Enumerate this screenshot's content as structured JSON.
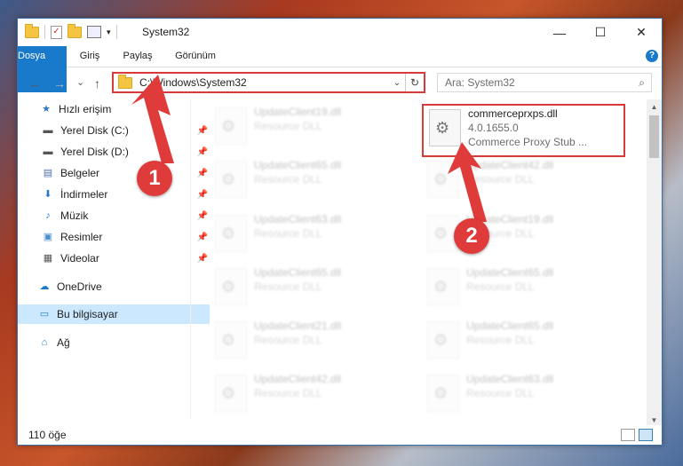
{
  "window": {
    "title": "System32",
    "minimize": "—",
    "maximize": "☐",
    "close": "✕"
  },
  "ribbon": {
    "tabs": [
      "Dosya",
      "Giriş",
      "Paylaş",
      "Görünüm"
    ],
    "help": "?"
  },
  "nav": {
    "back": "←",
    "forward": "→",
    "recent": "⌄",
    "up": "↑"
  },
  "address": {
    "path": "C:\\Windows\\System32",
    "dropdown": "⌄",
    "refresh": "↻"
  },
  "search": {
    "placeholder": "Ara: System32",
    "icon": "⌕"
  },
  "sidebar": {
    "items": [
      {
        "label": "Hızlı erişim",
        "icon": "★",
        "pinned": false
      },
      {
        "label": "Yerel Disk (C:)",
        "icon": "▬",
        "pinned": true
      },
      {
        "label": "Yerel Disk (D:)",
        "icon": "▬",
        "pinned": true
      },
      {
        "label": "Belgeler",
        "icon": "▤",
        "pinned": true
      },
      {
        "label": "İndirmeler",
        "icon": "⬇",
        "pinned": true
      },
      {
        "label": "Müzik",
        "icon": "♪",
        "pinned": true
      },
      {
        "label": "Resimler",
        "icon": "▣",
        "pinned": true
      },
      {
        "label": "Videolar",
        "icon": "▦",
        "pinned": true
      },
      {
        "label": "OneDrive",
        "icon": "☁",
        "pinned": false
      },
      {
        "label": "Bu bilgisayar",
        "icon": "▭",
        "pinned": false
      },
      {
        "label": "Ağ",
        "icon": "⌂",
        "pinned": false
      }
    ],
    "pin_glyph": "📌"
  },
  "files": {
    "left_column": [
      {
        "name": "UpdateClient19.dll",
        "type": "Resource DLL"
      },
      {
        "name": "UpdateClient65.dll",
        "type": "Resource DLL"
      },
      {
        "name": "UpdateClient63.dll",
        "type": "Resource DLL"
      },
      {
        "name": "UpdateClient65.dll",
        "type": "Resource DLL"
      },
      {
        "name": "UpdateClient21.dll",
        "type": "Resource DLL"
      },
      {
        "name": "UpdateClient42.dll",
        "type": "Resource DLL"
      }
    ],
    "right_column": [
      {
        "name": "UpdateClient42.dll",
        "type": "Resource DLL"
      },
      {
        "name": "UpdateClient19.dll",
        "type": "Resource DLL"
      },
      {
        "name": "UpdateClient65.dll",
        "type": "Resource DLL"
      },
      {
        "name": "UpdateClient65.dll",
        "type": "Resource DLL"
      },
      {
        "name": "UpdateClient63.dll",
        "type": "Resource DLL"
      }
    ],
    "highlighted": {
      "name": "commerceprxps.dll",
      "version": "4.0.1655.0",
      "description": "Commerce Proxy Stub ..."
    }
  },
  "status": {
    "count": "110 öğe"
  },
  "markers": [
    "1",
    "2"
  ],
  "colors": {
    "accent": "#1979ca",
    "highlight": "#d83a3a",
    "marker": "#e03b3b"
  }
}
